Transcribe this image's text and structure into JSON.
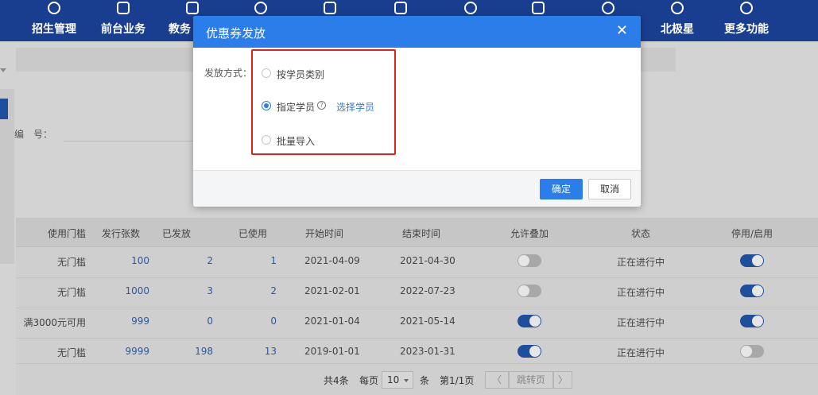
{
  "nav": {
    "items": [
      {
        "label": "招生管理",
        "icon": "user-plus-icon"
      },
      {
        "label": "前台业务",
        "icon": "desk-icon"
      },
      {
        "label": "教务",
        "icon": "book-icon"
      },
      {
        "label": "",
        "icon": "person-icon"
      },
      {
        "label": "",
        "icon": "import-icon"
      },
      {
        "label": "",
        "icon": "home-icon"
      },
      {
        "label": "",
        "icon": "cycle-icon"
      },
      {
        "label": "",
        "icon": "stats-icon"
      },
      {
        "label": "",
        "icon": "target-icon"
      },
      {
        "label": "北极星",
        "icon": "star-icon"
      },
      {
        "label": "更多功能",
        "icon": "more-icon"
      }
    ]
  },
  "filter": {
    "code_label": "编　号："
  },
  "table": {
    "headers": [
      "使用门槛",
      "发行张数",
      "已发放",
      "已使用",
      "开始时间",
      "结束时间",
      "允许叠加",
      "状态",
      "停用/启用"
    ],
    "rows": [
      {
        "threshold": "无门槛",
        "issued": "100",
        "distributed": "2",
        "used": "1",
        "start": "2021-04-09",
        "end": "2021-04-30",
        "stack": false,
        "status": "正在进行中",
        "enabled": true
      },
      {
        "threshold": "无门槛",
        "issued": "1000",
        "distributed": "3",
        "used": "2",
        "start": "2021-02-01",
        "end": "2022-07-23",
        "stack": false,
        "status": "正在进行中",
        "enabled": true
      },
      {
        "threshold": "满3000元可用",
        "issued": "999",
        "distributed": "0",
        "used": "0",
        "start": "2021-01-04",
        "end": "2021-05-14",
        "stack": true,
        "status": "正在进行中",
        "enabled": true
      },
      {
        "threshold": "无门槛",
        "issued": "9999",
        "distributed": "198",
        "used": "13",
        "start": "2019-01-01",
        "end": "2023-01-31",
        "stack": true,
        "status": "正在进行中",
        "enabled": false
      }
    ]
  },
  "pagination": {
    "total": "共4条",
    "per_page_label": "每页",
    "per_page_value": "10",
    "unit": "条",
    "page_info": "第1/1页",
    "prev": "〈",
    "jump": "跳转页",
    "next": "〉"
  },
  "modal": {
    "title": "优惠券发放",
    "close": "✕",
    "field_label": "发放方式：",
    "options": [
      {
        "label": "按学员类别",
        "checked": false
      },
      {
        "label": "指定学员",
        "checked": true,
        "help": "?",
        "action": "选择学员"
      },
      {
        "label": "批量导入",
        "checked": false
      }
    ],
    "confirm": "确定",
    "cancel": "取消"
  },
  "colors": {
    "header": "#1a3e8f",
    "modal_header": "#2b7de9",
    "highlight": "#e02020"
  }
}
